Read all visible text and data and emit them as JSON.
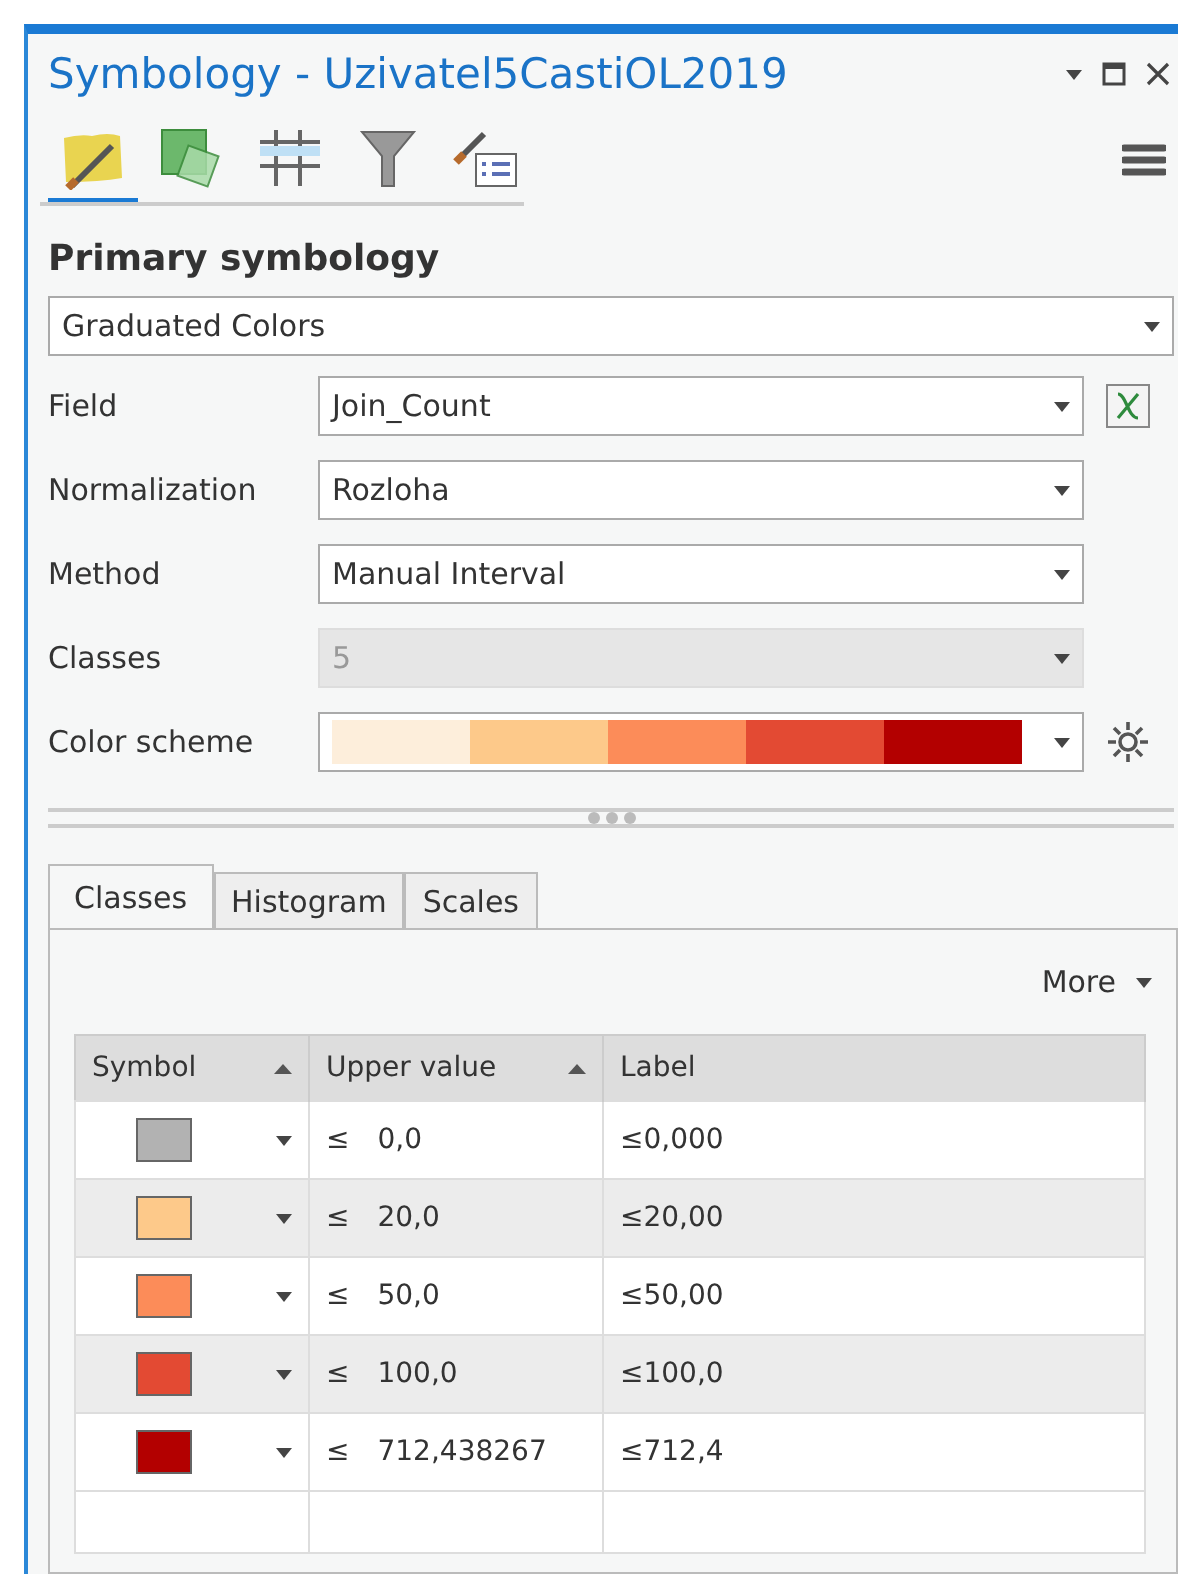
{
  "window": {
    "title": "Symbology - Uzivatel5CastiOL2019"
  },
  "toolbar_tabs": [
    {
      "kind": "symbology",
      "selected": true
    },
    {
      "kind": "vary",
      "selected": false
    },
    {
      "kind": "labels",
      "selected": false
    },
    {
      "kind": "filter",
      "selected": false
    },
    {
      "kind": "legend",
      "selected": false
    }
  ],
  "primary_symbology": {
    "heading": "Primary symbology",
    "renderer": "Graduated Colors"
  },
  "settings": [
    {
      "label": "Field",
      "kind": "dropdown",
      "value": "Join_Count",
      "disabled": false,
      "button": {
        "kind": "expression"
      }
    },
    {
      "label": "Normalization",
      "kind": "dropdown",
      "value": "Rozloha",
      "disabled": false
    },
    {
      "label": "Method",
      "kind": "dropdown",
      "value": "Manual Interval",
      "disabled": false
    },
    {
      "label": "Classes",
      "kind": "dropdown",
      "value": "5",
      "disabled": true
    },
    {
      "label": "Color scheme",
      "kind": "ramp",
      "disabled": false,
      "button": {
        "kind": "settings"
      },
      "stops": [
        {
          "color": "#fdeedb"
        },
        {
          "color": "#fdc98a"
        },
        {
          "color": "#fc8c59"
        },
        {
          "color": "#e34a33"
        },
        {
          "color": "#b30000"
        }
      ]
    }
  ],
  "tabs": [
    {
      "label": "Classes",
      "selected": true
    },
    {
      "label": "Histogram",
      "selected": false
    },
    {
      "label": "Scales",
      "selected": false
    }
  ],
  "more": "More",
  "table": {
    "columns": [
      {
        "label": "Symbol",
        "sorted": true
      },
      {
        "label": "Upper value",
        "sorted": true
      },
      {
        "label": "Label",
        "sorted": false
      }
    ],
    "rows": [
      {
        "color": "#b2b2b2",
        "operator": "≤",
        "upper_value": "0,0",
        "label": "≤0,000"
      },
      {
        "color": "#fdc98a",
        "operator": "≤",
        "upper_value": "20,0",
        "label": "≤20,00"
      },
      {
        "color": "#fc8c59",
        "operator": "≤",
        "upper_value": "50,0",
        "label": "≤50,00"
      },
      {
        "color": "#e34a33",
        "operator": "≤",
        "upper_value": "100,0",
        "label": "≤100,0"
      },
      {
        "color": "#b30000",
        "operator": "≤",
        "upper_value": "712,438267",
        "label": "≤712,4"
      }
    ]
  }
}
